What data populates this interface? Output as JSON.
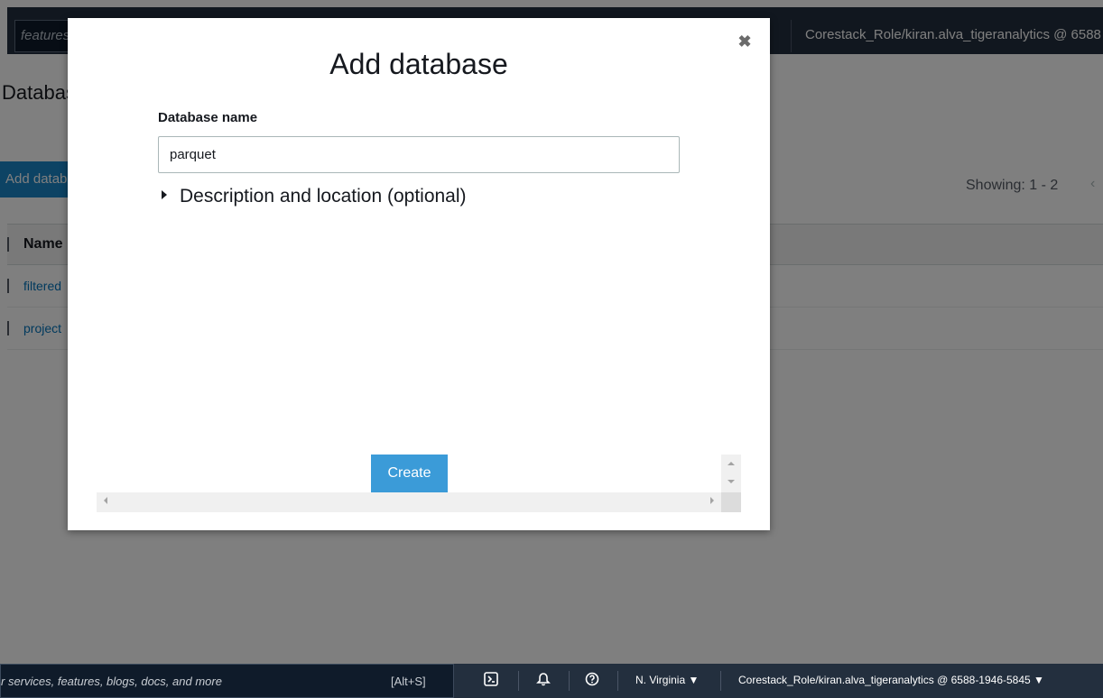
{
  "topbar": {
    "search_text": "features",
    "account": "Corestack_Role/kiran.alva_tigeranalytics @ 6588"
  },
  "page": {
    "title": "Databases",
    "add_button": "Add database",
    "showing": "Showing: 1 - 2",
    "columns": [
      "Name"
    ],
    "rows": [
      {
        "name": "filtered"
      },
      {
        "name": "project"
      }
    ]
  },
  "modal": {
    "title": "Add database",
    "db_name_label": "Database name",
    "db_name_value": "parquet",
    "expander_label": "Description and location (optional)",
    "create_label": "Create"
  },
  "bottombar": {
    "search_text": "r services, features, blogs, docs, and more",
    "shortcut": "[Alt+S]",
    "region": "N. Virginia ▼",
    "account": "Corestack_Role/kiran.alva_tigeranalytics @ 6588-1946-5845 ▼"
  },
  "icons": {
    "close": "close-icon",
    "expand": "caret-right-icon",
    "cloudshell": "cloudshell-icon",
    "notifications": "bell-icon",
    "help": "help-icon"
  },
  "colors": {
    "nav_bg": "#232f3e",
    "primary_button": "#3b9bd8",
    "link": "#0073bb"
  }
}
